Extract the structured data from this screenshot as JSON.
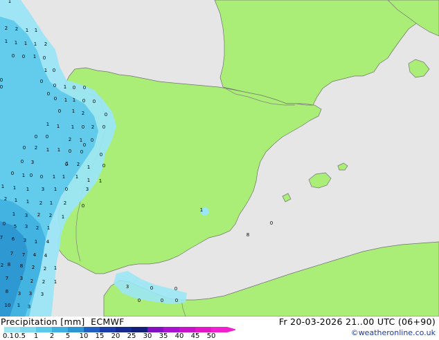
{
  "legend": {
    "title": "Precipitation [mm]",
    "model": "ECMWF",
    "valid_time": "Fr 20-03-2026 21..00 UTC (06+90)",
    "credit": "©weatheronline.co.uk",
    "scale_labels": [
      "0.1",
      "0.5",
      "1",
      "2",
      "5",
      "10",
      "15",
      "20",
      "25",
      "30",
      "35",
      "40",
      "45",
      "50"
    ],
    "scale_colors": [
      "#9be5f5",
      "#7fdaf0",
      "#5cc8ea",
      "#3fb0e0",
      "#2c95d2",
      "#2060c0",
      "#1a3aa8",
      "#162a90",
      "#12207a",
      "#8010c0",
      "#a812d0",
      "#c814c8",
      "#e018c8",
      "#f020d0"
    ]
  },
  "colors": {
    "land": "#aaee77",
    "sea": "#e6e6e6",
    "border": "#808080",
    "coast": "#707070"
  },
  "precip_values": [
    {
      "v": "1"
    },
    {
      "v": "2"
    },
    {
      "v": "2"
    },
    {
      "v": "1"
    },
    {
      "v": "1"
    },
    {
      "v": "1"
    },
    {
      "v": "1"
    },
    {
      "v": "1"
    },
    {
      "v": "2"
    },
    {
      "v": "1"
    },
    {
      "v": "0"
    },
    {
      "v": "0"
    },
    {
      "v": "1"
    },
    {
      "v": "0"
    },
    {
      "v": "0"
    },
    {
      "v": "1"
    },
    {
      "v": "0"
    },
    {
      "v": "0"
    },
    {
      "v": "1"
    },
    {
      "v": "0"
    },
    {
      "v": "0"
    },
    {
      "v": "0"
    },
    {
      "v": "1"
    },
    {
      "v": "1"
    },
    {
      "v": "0"
    },
    {
      "v": "0"
    },
    {
      "v": "1"
    },
    {
      "v": "2"
    },
    {
      "v": "0"
    },
    {
      "v": "0"
    },
    {
      "v": "1"
    },
    {
      "v": "1"
    },
    {
      "v": "0"
    },
    {
      "v": "2"
    },
    {
      "v": "0"
    },
    {
      "v": "1"
    },
    {
      "v": "2"
    },
    {
      "v": "1"
    },
    {
      "v": "0"
    },
    {
      "v": "0"
    },
    {
      "v": "0"
    },
    {
      "v": "0"
    },
    {
      "v": "2"
    },
    {
      "v": "1"
    },
    {
      "v": "1"
    },
    {
      "v": "0"
    },
    {
      "v": "0"
    },
    {
      "v": "3"
    },
    {
      "v": "0"
    },
    {
      "v": "1"
    },
    {
      "v": "0"
    },
    {
      "v": "0"
    },
    {
      "v": "0"
    },
    {
      "v": "2"
    },
    {
      "v": "1"
    },
    {
      "v": "1"
    },
    {
      "v": "0"
    },
    {
      "v": "0"
    },
    {
      "v": "1"
    },
    {
      "v": "1"
    },
    {
      "v": "1"
    },
    {
      "v": "1"
    },
    {
      "v": "1"
    },
    {
      "v": "1"
    },
    {
      "v": "3"
    },
    {
      "v": "1"
    },
    {
      "v": "0"
    },
    {
      "v": "1"
    },
    {
      "v": "1"
    },
    {
      "v": "3"
    },
    {
      "v": "2"
    },
    {
      "v": "1"
    },
    {
      "v": "1"
    },
    {
      "v": "2"
    },
    {
      "v": "1"
    },
    {
      "v": "2"
    },
    {
      "v": "1"
    },
    {
      "v": "3"
    },
    {
      "v": "2"
    },
    {
      "v": "2"
    },
    {
      "v": "1"
    },
    {
      "v": "0"
    },
    {
      "v": "5"
    },
    {
      "v": "3"
    },
    {
      "v": "2"
    },
    {
      "v": "1"
    },
    {
      "v": "7"
    },
    {
      "v": "6"
    },
    {
      "v": "3"
    },
    {
      "v": "1"
    },
    {
      "v": "4"
    },
    {
      "v": "7"
    },
    {
      "v": "7"
    },
    {
      "v": "4"
    },
    {
      "v": "4"
    },
    {
      "v": "2"
    },
    {
      "v": "8"
    },
    {
      "v": "8"
    },
    {
      "v": "2"
    },
    {
      "v": "2"
    },
    {
      "v": "1"
    },
    {
      "v": "7"
    },
    {
      "v": "3"
    },
    {
      "v": "2"
    },
    {
      "v": "2"
    },
    {
      "v": "1"
    },
    {
      "v": "8"
    },
    {
      "v": "3"
    },
    {
      "v": "3"
    },
    {
      "v": "3"
    },
    {
      "v": "1"
    },
    {
      "v": "10"
    },
    {
      "v": "3"
    },
    {
      "v": "1"
    },
    {
      "v": "0"
    },
    {
      "v": "8"
    },
    {
      "v": "3"
    },
    {
      "v": "0"
    },
    {
      "v": "0"
    },
    {
      "v": "0"
    },
    {
      "v": "0"
    },
    {
      "v": "0"
    },
    {
      "v": "0"
    },
    {
      "v": "0"
    },
    {
      "v": "0"
    },
    {
      "v": "0"
    },
    {
      "v": "0"
    },
    {
      "v": "0"
    }
  ]
}
